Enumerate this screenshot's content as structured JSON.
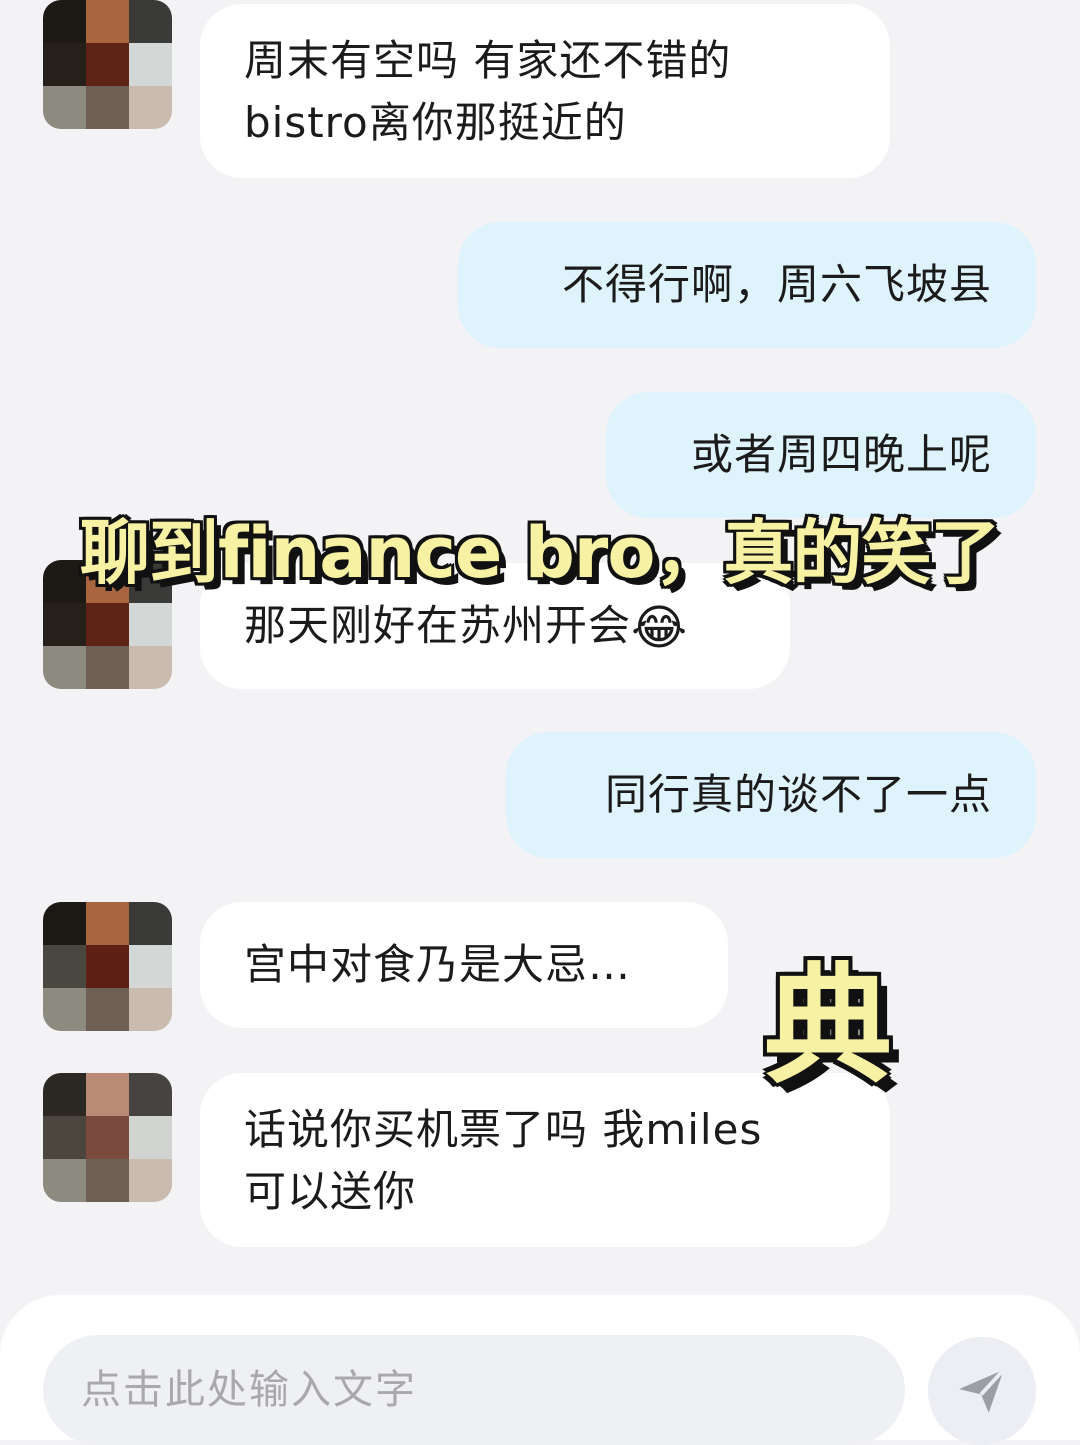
{
  "messages": [
    {
      "side": "in",
      "lines": [
        "周末有空吗 有家还不错的",
        "bistro离你那挺近的"
      ]
    },
    {
      "side": "out",
      "lines": [
        "不得行啊，周六飞坡县"
      ]
    },
    {
      "side": "out",
      "lines": [
        "或者周四晚上呢"
      ]
    },
    {
      "side": "in",
      "lines": [
        "那天刚好在苏州开会"
      ],
      "emoji": "😂"
    },
    {
      "side": "out",
      "lines": [
        "同行真的谈不了一点"
      ]
    },
    {
      "side": "in",
      "lines": [
        "宫中对食乃是大忌…"
      ]
    },
    {
      "side": "in",
      "lines": [
        "话说你买机票了吗 我miles",
        "可以送你"
      ]
    }
  ],
  "overlay": {
    "caption": "聊到finance bro，真的笑了",
    "sticker": "典"
  },
  "input": {
    "placeholder": "点击此处输入文字"
  },
  "icons": {
    "send": "send-icon"
  },
  "colors": {
    "incoming_bubble": "#ffffff",
    "outgoing_bubble": "#dff3fc",
    "background": "#f3f3f6",
    "overlay_text": "#f6f1a3"
  }
}
